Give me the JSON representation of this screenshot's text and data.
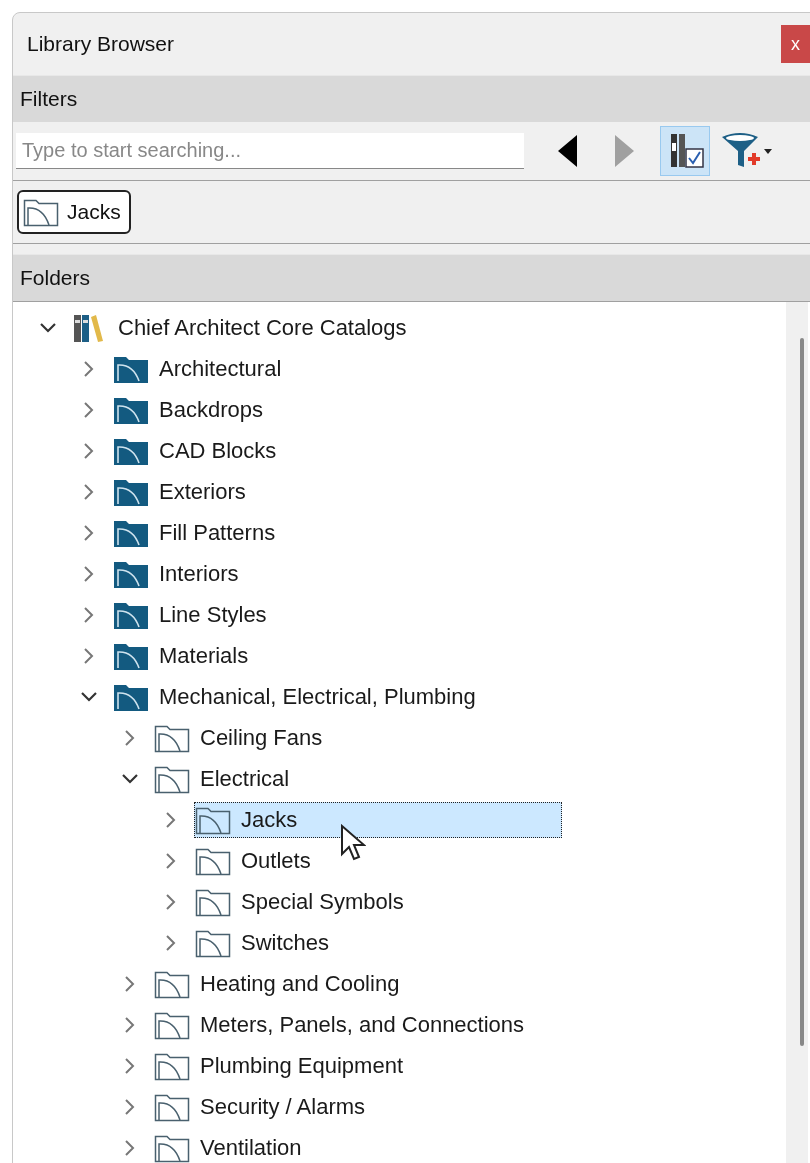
{
  "window": {
    "title": "Library Browser",
    "close": "x"
  },
  "filters": {
    "header": "Filters",
    "search": {
      "placeholder": "Type to start searching..."
    },
    "toolbar": [
      {
        "kind": "back",
        "disabled": false
      },
      {
        "kind": "forward",
        "disabled": true
      },
      {
        "kind": "view-toggle",
        "pressed": true
      },
      {
        "kind": "filter"
      }
    ],
    "chips": [
      {
        "label": "Jacks"
      }
    ]
  },
  "folders": {
    "header": "Folders",
    "tree": [
      {
        "label": "Chief Architect Core Catalogs",
        "kind": "catalog",
        "expanded": true,
        "selected": false,
        "children": [
          {
            "label": "Architectural",
            "kind": "filled",
            "expanded": false,
            "selected": false
          },
          {
            "label": "Backdrops",
            "kind": "filled",
            "expanded": false,
            "selected": false
          },
          {
            "label": "CAD Blocks",
            "kind": "filled",
            "expanded": false,
            "selected": false
          },
          {
            "label": "Exteriors",
            "kind": "filled",
            "expanded": false,
            "selected": false
          },
          {
            "label": "Fill Patterns",
            "kind": "filled",
            "expanded": false,
            "selected": false
          },
          {
            "label": "Interiors",
            "kind": "filled",
            "expanded": false,
            "selected": false
          },
          {
            "label": "Line Styles",
            "kind": "filled",
            "expanded": false,
            "selected": false
          },
          {
            "label": "Materials",
            "kind": "filled",
            "expanded": false,
            "selected": false
          },
          {
            "label": "Mechanical, Electrical, Plumbing",
            "kind": "filled",
            "expanded": true,
            "selected": false,
            "children": [
              {
                "label": "Ceiling Fans",
                "kind": "outline",
                "expanded": false,
                "selected": false
              },
              {
                "label": "Electrical",
                "kind": "outline",
                "expanded": true,
                "selected": false,
                "children": [
                  {
                    "label": "Jacks",
                    "kind": "outline",
                    "expanded": false,
                    "selected": true
                  },
                  {
                    "label": "Outlets",
                    "kind": "outline",
                    "expanded": false,
                    "selected": false
                  },
                  {
                    "label": "Special Symbols",
                    "kind": "outline",
                    "expanded": false,
                    "selected": false
                  },
                  {
                    "label": "Switches",
                    "kind": "outline",
                    "expanded": false,
                    "selected": false
                  }
                ]
              },
              {
                "label": "Heating and Cooling",
                "kind": "outline",
                "expanded": false,
                "selected": false
              },
              {
                "label": "Meters, Panels, and Connections",
                "kind": "outline",
                "expanded": false,
                "selected": false
              },
              {
                "label": "Plumbing Equipment",
                "kind": "outline",
                "expanded": false,
                "selected": false
              },
              {
                "label": "Security / Alarms",
                "kind": "outline",
                "expanded": false,
                "selected": false
              },
              {
                "label": "Ventilation",
                "kind": "outline",
                "expanded": false,
                "selected": false
              }
            ]
          }
        ]
      }
    ]
  }
}
